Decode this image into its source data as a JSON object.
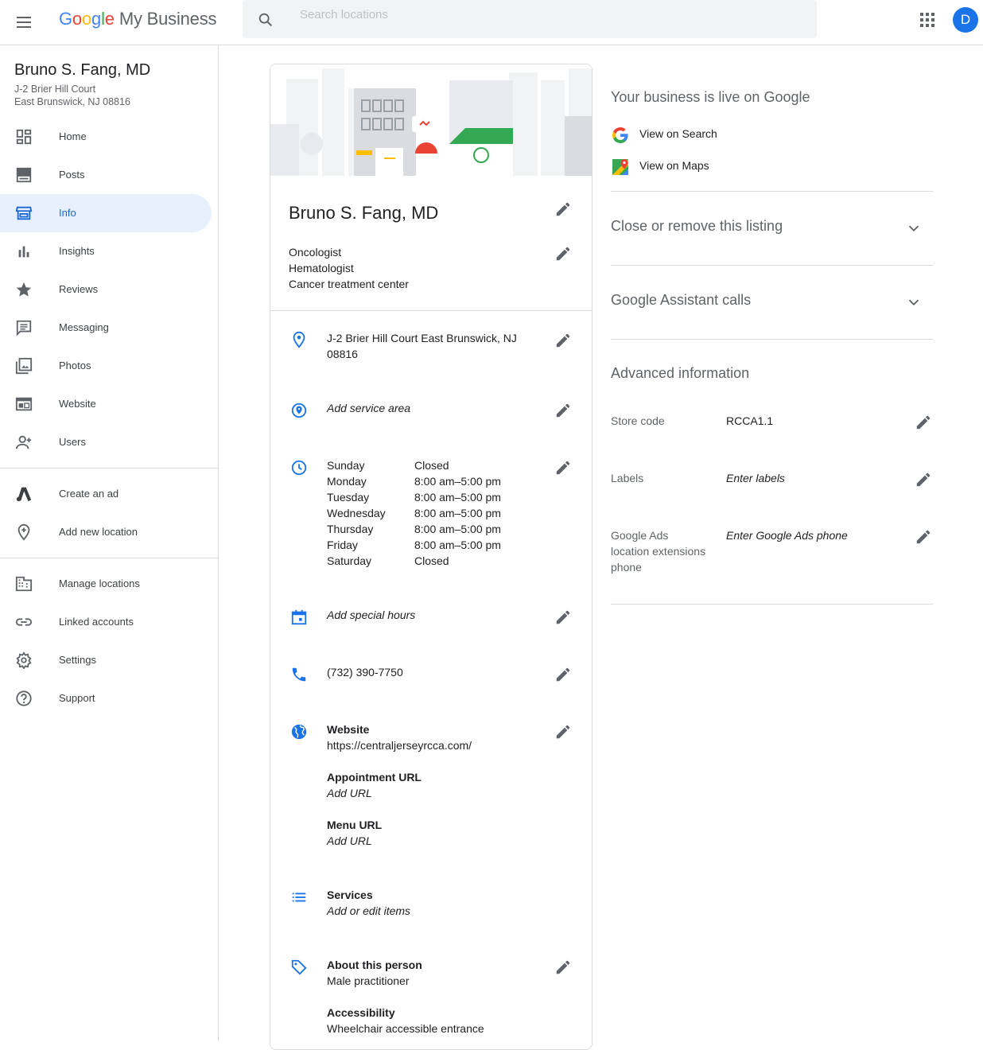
{
  "header": {
    "brand_google": "Google",
    "brand_product": "My Business",
    "search_placeholder": "Search locations",
    "avatar_letter": "D"
  },
  "sidebar": {
    "business_name": "Bruno S. Fang, MD",
    "address_line1": "J-2 Brier Hill Court",
    "address_line2": "East Brunswick, NJ 08816",
    "items": [
      {
        "label": "Home",
        "icon": "dashboard-icon"
      },
      {
        "label": "Posts",
        "icon": "posts-icon"
      },
      {
        "label": "Info",
        "icon": "storefront-icon"
      },
      {
        "label": "Insights",
        "icon": "bar-chart-icon"
      },
      {
        "label": "Reviews",
        "icon": "star-icon"
      },
      {
        "label": "Messaging",
        "icon": "message-icon"
      },
      {
        "label": "Photos",
        "icon": "photos-icon"
      },
      {
        "label": "Website",
        "icon": "website-icon"
      },
      {
        "label": "Users",
        "icon": "add-user-icon"
      },
      {
        "label": "Create an ad",
        "icon": "google-ads-icon"
      },
      {
        "label": "Add new location",
        "icon": "add-location-icon"
      },
      {
        "label": "Manage locations",
        "icon": "building-icon"
      },
      {
        "label": "Linked accounts",
        "icon": "link-icon"
      },
      {
        "label": "Settings",
        "icon": "gear-icon"
      },
      {
        "label": "Support",
        "icon": "help-icon"
      }
    ],
    "active_item": "Info"
  },
  "card": {
    "title": "Bruno S. Fang, MD",
    "categories": [
      "Oncologist",
      "Hematologist",
      "Cancer treatment center"
    ],
    "address_line1": "J-2 Brier Hill Court East Brunswick, NJ",
    "address_line2": "08816",
    "service_area": "Add service area",
    "hours": [
      {
        "day": "Sunday",
        "time": "Closed"
      },
      {
        "day": "Monday",
        "time": "8:00 am–5:00 pm"
      },
      {
        "day": "Tuesday",
        "time": "8:00 am–5:00 pm"
      },
      {
        "day": "Wednesday",
        "time": "8:00 am–5:00 pm"
      },
      {
        "day": "Thursday",
        "time": "8:00 am–5:00 pm"
      },
      {
        "day": "Friday",
        "time": "8:00 am–5:00 pm"
      },
      {
        "day": "Saturday",
        "time": "Closed"
      }
    ],
    "special_hours": "Add special hours",
    "phone": "(732) 390-7750",
    "website_label": "Website",
    "website_url": "https://centraljerseyrcca.com/",
    "appointment_label": "Appointment URL",
    "appointment_value": "Add URL",
    "menu_label": "Menu URL",
    "menu_value": "Add URL",
    "services_label": "Services",
    "services_value": "Add or edit items",
    "about_label": "About this person",
    "about_value": "Male practitioner",
    "accessibility_label": "Accessibility",
    "accessibility_value": "Wheelchair accessible entrance"
  },
  "right_panel": {
    "live_title": "Your business is live on Google",
    "view_search": "View on Search",
    "view_maps": "View on Maps",
    "close_listing": "Close or remove this listing",
    "assistant_calls": "Google Assistant calls",
    "advanced_title": "Advanced information",
    "store_code_label": "Store code",
    "store_code_value": "RCCA1.1",
    "labels_label": "Labels",
    "labels_value": "Enter labels",
    "ads_phone_label": "Google Ads location extensions phone",
    "ads_phone_value": "Enter Google Ads phone"
  },
  "colors": {
    "accent_blue": "#1a73e8",
    "active_bg": "#e8f0fe",
    "divider": "#dadce0",
    "icon_grey": "#5f6368"
  }
}
